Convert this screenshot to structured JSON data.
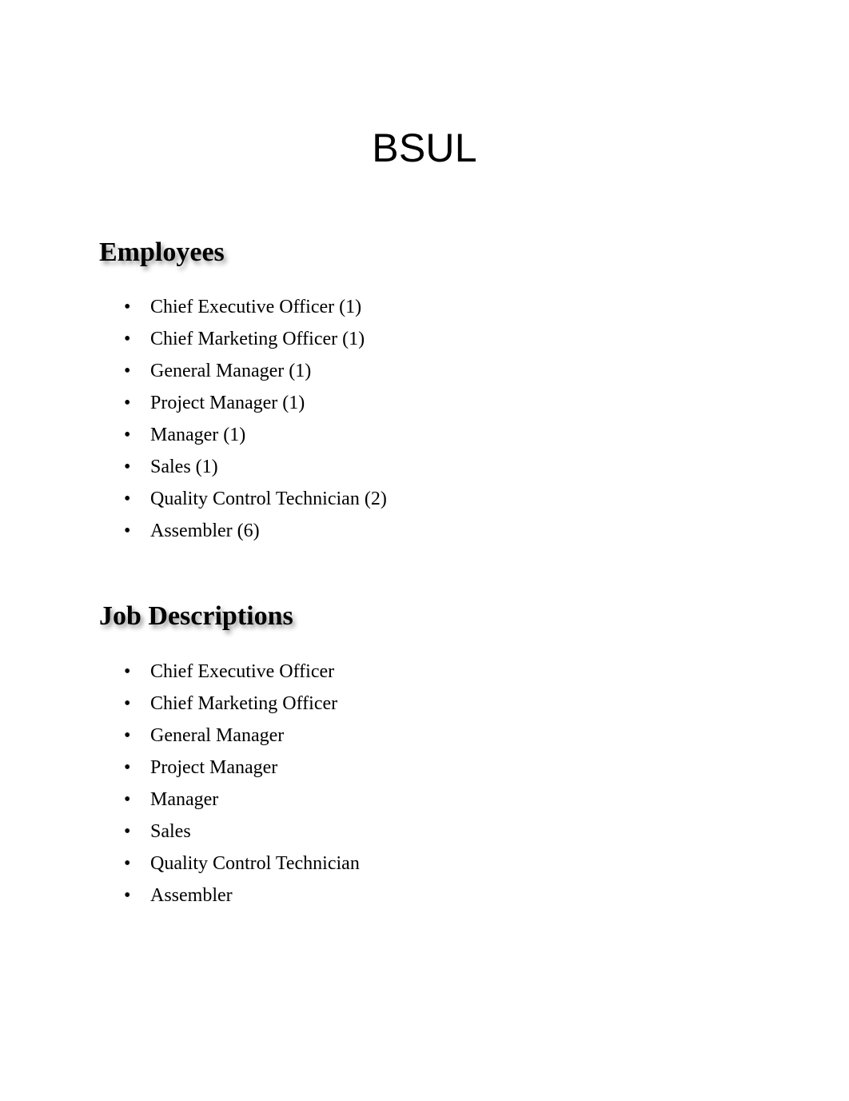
{
  "document": {
    "title": "BSUL"
  },
  "sections": [
    {
      "heading": "Employees",
      "bullet": "•",
      "items": [
        "Chief Executive Officer (1)",
        "Chief Marketing Officer (1)",
        "General Manager (1)",
        "Project Manager (1)",
        "Manager (1)",
        "Sales (1)",
        "Quality Control Technician (2)",
        "Assembler (6)"
      ]
    },
    {
      "heading": "Job Descriptions",
      "bullet": "•",
      "items": [
        "Chief Executive Officer",
        "Chief Marketing Officer",
        "General Manager",
        "Project Manager",
        "Manager",
        "Sales",
        "Quality Control Technician",
        "Assembler"
      ]
    }
  ],
  "colors": {
    "page_background": "#ffffff",
    "text": "#000000",
    "heading_shadow": "rgba(0,0,0,0.42)"
  }
}
